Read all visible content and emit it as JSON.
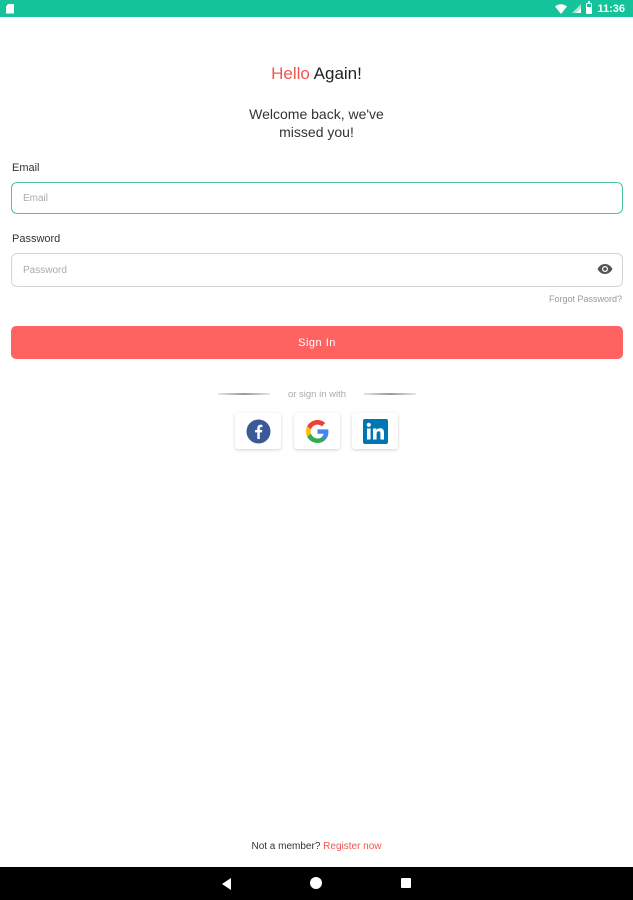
{
  "status_bar": {
    "time": "11:36",
    "background": "#15c39a"
  },
  "header": {
    "title_accent": "Hello",
    "title_rest": " Again!",
    "subtitle_line1": "Welcome back, we've",
    "subtitle_line2": "missed you!"
  },
  "form": {
    "email_label": "Email",
    "email_placeholder": "Email",
    "email_value": "",
    "password_label": "Password",
    "password_placeholder": "Password",
    "password_value": "",
    "forgot_password": "Forgot Password?",
    "signin_label": "Sign In"
  },
  "social": {
    "divider_text": "or sign in with",
    "providers": [
      {
        "name": "facebook-icon"
      },
      {
        "name": "google-icon"
      },
      {
        "name": "linkedin-icon"
      }
    ]
  },
  "footer": {
    "prompt": "Not a member? ",
    "register_link": "Register now"
  },
  "colors": {
    "accent": "#f2554f",
    "button": "#fe6361",
    "focus_border": "#4ec49f"
  }
}
